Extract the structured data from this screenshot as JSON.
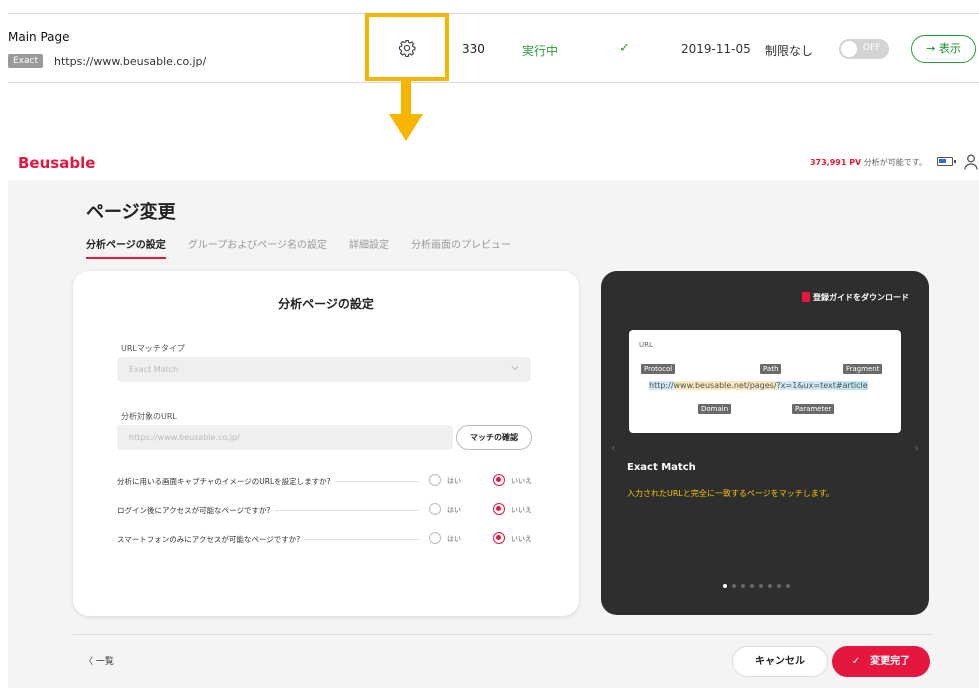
{
  "list_row": {
    "title": "Main Page",
    "match_badge": "Exact",
    "url": "https://www.beusable.co.jp/",
    "count": "330",
    "status": "実行中",
    "check": "✓",
    "date": "2019-11-05",
    "limit": "制限なし",
    "toggle_label": "OFF",
    "view_button": "→ 表示"
  },
  "colors": {
    "brand": "#e5173f",
    "highlight": "#f7b500",
    "success": "#2a9a3a",
    "guide_accent": "#f7c800"
  },
  "app": {
    "logo": "Beusable",
    "pv_count": "373,991 PV",
    "pv_suffix": "分析が可能です。",
    "page_title": "ページ変更",
    "tabs": [
      {
        "label": "分析ページの設定",
        "active": true
      },
      {
        "label": "グループおよびページ名の設定",
        "active": false
      },
      {
        "label": "詳細設定",
        "active": false
      },
      {
        "label": "分析画面のプレビュー",
        "active": false
      }
    ]
  },
  "settings": {
    "title": "分析ページの設定",
    "url_match_label": "URLマッチタイプ",
    "url_match_value": "Exact Match",
    "target_url_label": "分析対象のURL",
    "target_url_value": "https://www.beusable.co.jp/",
    "match_check_button": "マッチの確認",
    "questions": [
      {
        "text": "分析に用いる画面キャプチャのイメージのURLを設定しますか?",
        "yes": "はい",
        "no": "いいえ",
        "selected": "no"
      },
      {
        "text": "ログイン後にアクセスが可能なページですか?",
        "yes": "はい",
        "no": "いいえ",
        "selected": "no"
      },
      {
        "text": "スマートフォンのみにアクセスが可能なページですか?",
        "yes": "はい",
        "no": "いいえ",
        "selected": "no"
      }
    ]
  },
  "guide": {
    "download_label": "登録ガイドをダウンロード",
    "url_title": "URL",
    "tags": {
      "protocol": "Protocol",
      "path": "Path",
      "fragment": "Fragment",
      "domain": "Domain",
      "parameter": "Parameter"
    },
    "url_segments": {
      "protocol": "http://",
      "domain": "www.beusable.net",
      "path": "/pages/",
      "parameter": "?x=1&ux=text",
      "fragment": "#article"
    },
    "nav_prev": "‹",
    "nav_next": "›",
    "heading": "Exact Match",
    "description": "入力されたURLと完全に一致するページをマッチします。",
    "dots_total": 8,
    "dots_active": 1
  },
  "footer": {
    "back_link": "〈 一覧",
    "cancel": "キャンセル",
    "done": "✓　変更完了"
  }
}
